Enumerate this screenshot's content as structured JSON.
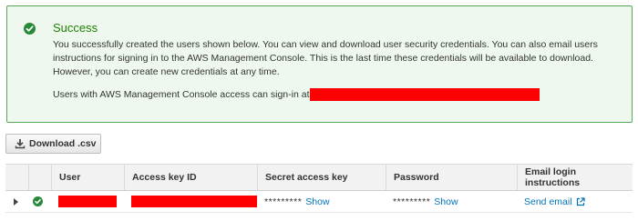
{
  "alert": {
    "status_icon": "check-circle-icon",
    "title": "Success",
    "body": "You successfully created the users shown below. You can view and download user security credentials. You can also email users instructions for signing in to the AWS Management Console. This is the last time these credentials will be available to download. However, you can create new credentials at any time.",
    "signin_text": "Users with AWS Management Console access can sign-in at",
    "colors": {
      "background": "#eff8ef",
      "border": "#56a856",
      "title": "#1d8102",
      "icon": "#29883a"
    }
  },
  "download_button": {
    "icon": "download-icon",
    "label": "Download .csv"
  },
  "table": {
    "columns": [
      "",
      "",
      "User",
      "Access key ID",
      "Secret access key",
      "Password",
      "Email login instructions"
    ],
    "rows": [
      {
        "expand_icon": "caret-right-icon",
        "status_icon": "check-circle-icon",
        "secret_mask": "*********",
        "secret_action": "Show",
        "password_mask": "*********",
        "password_action": "Show",
        "email_action": "Send email",
        "email_icon": "external-link-icon"
      }
    ]
  },
  "link_color": "#0073bb"
}
